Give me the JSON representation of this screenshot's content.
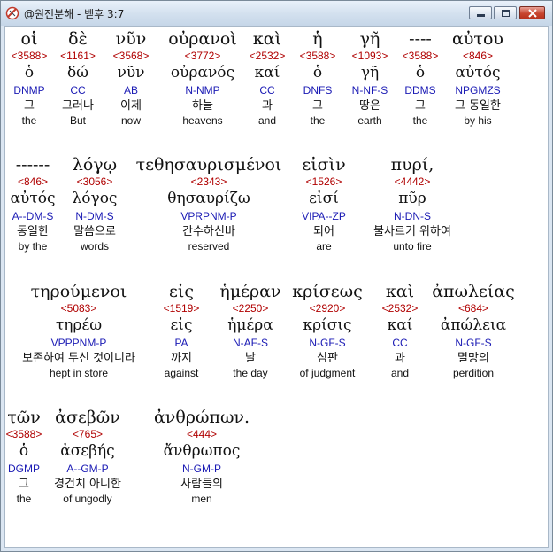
{
  "window": {
    "title": "@원전분해 - 벧후 3:7",
    "controls": {
      "minimize": "minimize",
      "maximize": "maximize",
      "close": "close"
    }
  },
  "words": [
    {
      "greek": "οἱ",
      "strong": "<3588>",
      "lemma": "ὁ",
      "parse": "DNMP",
      "korean": "그",
      "english": "the"
    },
    {
      "greek": "δὲ",
      "strong": "<1161>",
      "lemma": "δώ",
      "parse": "CC",
      "korean": "그러나",
      "english": "But"
    },
    {
      "greek": "νῦν",
      "strong": "<3568>",
      "lemma": "νῦν",
      "parse": "AB",
      "korean": "이제",
      "english": "now"
    },
    {
      "greek": "οὐρανοὶ",
      "strong": "<3772>",
      "lemma": "οὐρανός",
      "parse": "N-NMP",
      "korean": "하늘",
      "english": "heavens"
    },
    {
      "greek": "καὶ",
      "strong": "<2532>",
      "lemma": "καί",
      "parse": "CC",
      "korean": "과",
      "english": "and"
    },
    {
      "greek": "ἡ",
      "strong": "<3588>",
      "lemma": "ὁ",
      "parse": "DNFS",
      "korean": "그",
      "english": "the"
    },
    {
      "greek": "γῆ",
      "strong": "<1093>",
      "lemma": "γῆ",
      "parse": "N-NF-S",
      "korean": "땅은",
      "english": "earth"
    },
    {
      "greek": "----",
      "strong": "<3588>",
      "lemma": "ὁ",
      "parse": "DDMS",
      "korean": "그",
      "english": "the"
    },
    {
      "greek": "αὐτου",
      "strong": "<846>",
      "lemma": "αὐτός",
      "parse": "NPGMZS",
      "korean": "그 동일한",
      "english": "by his"
    },
    {
      "greek": "------",
      "strong": "<846>",
      "lemma": "αὐτός",
      "parse": "A--DM-S",
      "korean": "동일한",
      "english": "by the"
    },
    {
      "greek": "λόγῳ",
      "strong": "<3056>",
      "lemma": "λόγος",
      "parse": "N-DM-S",
      "korean": "말씀으로",
      "english": "words"
    },
    {
      "greek": "τεθησαυρισμένοι",
      "strong": "<2343>",
      "lemma": "θησαυρίζω",
      "parse": "VPRPNM-P",
      "korean": "간수하신바",
      "english": "reserved"
    },
    {
      "greek": "εἰσὶν",
      "strong": "<1526>",
      "lemma": "εἰσί",
      "parse": "VIPA--ZP",
      "korean": "되어",
      "english": "are"
    },
    {
      "greek": "πυρί,",
      "strong": "<4442>",
      "lemma": "πῦρ",
      "parse": "N-DN-S",
      "korean": "불사르기 위하여",
      "english": "unto fire"
    },
    {
      "greek": "τηρούμενοι",
      "strong": "<5083>",
      "lemma": "τηρέω",
      "parse": "VPPPNM-P",
      "korean": "보존하여 두신 것이니라",
      "english": "hept in store"
    },
    {
      "greek": "εἰς",
      "strong": "<1519>",
      "lemma": "εἰς",
      "parse": "PA",
      "korean": "까지",
      "english": "against"
    },
    {
      "greek": "ἡμέραν",
      "strong": "<2250>",
      "lemma": "ἡμέρα",
      "parse": "N-AF-S",
      "korean": "날",
      "english": "the day"
    },
    {
      "greek": "κρίσεως",
      "strong": "<2920>",
      "lemma": "κρίσις",
      "parse": "N-GF-S",
      "korean": "심판",
      "english": "of judgment"
    },
    {
      "greek": "καὶ",
      "strong": "<2532>",
      "lemma": "καί",
      "parse": "CC",
      "korean": "과",
      "english": "and"
    },
    {
      "greek": "ἀπωλείας",
      "strong": "<684>",
      "lemma": "ἀπώλεια",
      "parse": "N-GF-S",
      "korean": "멸망의",
      "english": "perdition"
    },
    {
      "greek": "τῶν",
      "strong": "<3588>",
      "lemma": "ὁ",
      "parse": "DGMP",
      "korean": "그",
      "english": "the"
    },
    {
      "greek": "ἀσεβῶν",
      "strong": "<765>",
      "lemma": "ἀσεβής",
      "parse": "A--GM-P",
      "korean": "경건치 아니한",
      "english": "of ungodly"
    },
    {
      "greek": "ἀνθρώπων.",
      "strong": "<444>",
      "lemma": "ἄνθρωπος",
      "parse": "N-GM-P",
      "korean": "사람들의",
      "english": "men"
    }
  ]
}
